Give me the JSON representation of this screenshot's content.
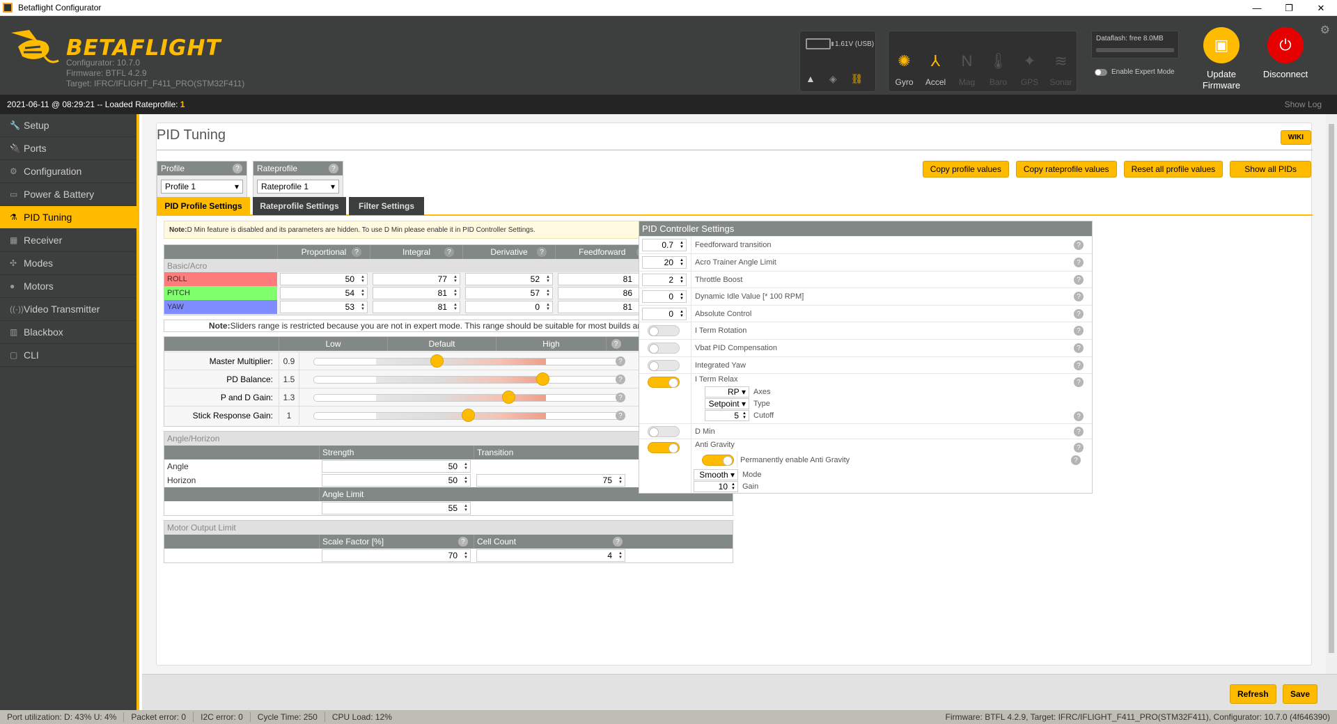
{
  "window": {
    "title": "Betaflight Configurator",
    "minimize": "—",
    "maximize": "❐",
    "close": "✕"
  },
  "header": {
    "logo_text": "BETAFLIGHT",
    "configurator": "Configurator: 10.7.0",
    "firmware": "Firmware: BTFL 4.2.9",
    "target": "Target: IFRC/IFLIGHT_F411_PRO(STM32F411)",
    "battery": "1.61V (USB)",
    "sensors": [
      {
        "label": "Gyro",
        "icon": "gyro-icon",
        "state": "on"
      },
      {
        "label": "Accel",
        "icon": "accel-icon",
        "state": "on"
      },
      {
        "label": "Mag",
        "icon": "mag-icon",
        "state": "off"
      },
      {
        "label": "Baro",
        "icon": "baro-icon",
        "state": "off"
      },
      {
        "label": "GPS",
        "icon": "gps-icon",
        "state": "off"
      },
      {
        "label": "Sonar",
        "icon": "sonar-icon",
        "state": "off"
      }
    ],
    "dataflash": "Dataflash: free 8.0MB",
    "expert_mode": "Enable Expert Mode",
    "update_firmware": "Update Firmware",
    "disconnect": "Disconnect"
  },
  "log": {
    "text": "2021-06-11 @ 08:29:21 -- Loaded Rateprofile: ",
    "value": "1",
    "show_log": "Show Log"
  },
  "sidebar": {
    "items": [
      {
        "label": "Setup",
        "icon": "wrench-icon"
      },
      {
        "label": "Ports",
        "icon": "plug-icon"
      },
      {
        "label": "Configuration",
        "icon": "gear-icon"
      },
      {
        "label": "Power & Battery",
        "icon": "battery-icon"
      },
      {
        "label": "PID Tuning",
        "icon": "pid-icon",
        "active": true
      },
      {
        "label": "Receiver",
        "icon": "receiver-icon"
      },
      {
        "label": "Modes",
        "icon": "modes-icon"
      },
      {
        "label": "Motors",
        "icon": "motor-icon"
      },
      {
        "label": "Video Transmitter",
        "icon": "vtx-icon"
      },
      {
        "label": "Blackbox",
        "icon": "blackbox-icon"
      },
      {
        "label": "CLI",
        "icon": "terminal-icon"
      }
    ]
  },
  "page": {
    "title": "PID Tuning",
    "wiki": "WIKI",
    "profile": {
      "label": "Profile",
      "value": "Profile 1"
    },
    "rateprofile": {
      "label": "Rateprofile",
      "value": "Rateprofile 1"
    },
    "buttons": {
      "copy_profile": "Copy profile values",
      "copy_rateprofile": "Copy rateprofile values",
      "reset_profile": "Reset all profile values",
      "show_all": "Show all PIDs"
    },
    "tabs": [
      "PID Profile Settings",
      "Rateprofile Settings",
      "Filter Settings"
    ]
  },
  "note_dmin": {
    "bold": "Note:",
    "text": " D Min feature is disabled and its parameters are hidden. To use D Min please enable it in PID Controller Settings."
  },
  "pid_table": {
    "columns": [
      "Proportional",
      "Integral",
      "Derivative",
      "Feedforward"
    ],
    "section": "Basic/Acro",
    "rows": [
      {
        "axis": "ROLL",
        "color": "#ff7c7c",
        "values": [
          "50",
          "77",
          "52",
          "81"
        ]
      },
      {
        "axis": "PITCH",
        "color": "#7fff6b",
        "values": [
          "54",
          "81",
          "57",
          "86"
        ]
      },
      {
        "axis": "YAW",
        "color": "#7f8cff",
        "values": [
          "53",
          "81",
          "0",
          "81"
        ]
      }
    ]
  },
  "note_sliders": {
    "bold": "Note:",
    "text": " Sliders range is restricted because you are not in expert mode. This range should be suitable for most builds and beginners."
  },
  "sliders": {
    "headers": [
      "Low",
      "Default",
      "High"
    ],
    "rows": [
      {
        "label": "Master Multiplier:",
        "value": "0.9",
        "level": 0.4
      },
      {
        "label": "PD Balance:",
        "value": "1.5",
        "level": 0.74
      },
      {
        "label": "P and D Gain:",
        "value": "1.3",
        "level": 0.63
      },
      {
        "label": "Stick Response Gain:",
        "value": "1",
        "level": 0.5
      }
    ]
  },
  "angle_horizon": {
    "title": "Angle/Horizon",
    "strength": "Strength",
    "transition": "Transition",
    "angle_label": "Angle",
    "horizon_label": "Horizon",
    "angle_strength": "50",
    "horizon_strength": "50",
    "horizon_transition": "75",
    "angle_limit_label": "Angle Limit",
    "angle_limit": "55"
  },
  "motor_output": {
    "title": "Motor Output Limit",
    "scale_label": "Scale Factor [%]",
    "cell_label": "Cell Count",
    "scale": "70",
    "cells": "4"
  },
  "pid_controller": {
    "title": "PID Controller Settings",
    "feedforward_transition": {
      "value": "0.7",
      "label": "Feedforward transition"
    },
    "acro_trainer": {
      "value": "20",
      "label": "Acro Trainer Angle Limit"
    },
    "throttle_boost": {
      "value": "2",
      "label": "Throttle Boost"
    },
    "dynamic_idle": {
      "value": "0",
      "label": "Dynamic Idle Value [* 100 RPM]"
    },
    "absolute_control": {
      "value": "0",
      "label": "Absolute Control"
    },
    "iterm_rotation": "I Term Rotation",
    "vbat_comp": "Vbat PID Compensation",
    "integrated_yaw": "Integrated Yaw",
    "iterm_relax": {
      "label": "I Term Relax",
      "axes_value": "RP",
      "axes_label": "Axes",
      "type_value": "Setpoint",
      "type_label": "Type",
      "cutoff_value": "5",
      "cutoff_label": "Cutoff"
    },
    "dmin": "D Min",
    "anti_gravity": {
      "label": "Anti Gravity",
      "permanent": "Permanently enable Anti Gravity",
      "mode_value": "Smooth",
      "mode_label": "Mode",
      "gain_value": "10",
      "gain_label": "Gain"
    }
  },
  "bottom": {
    "refresh": "Refresh",
    "save": "Save"
  },
  "status": {
    "port": "Port utilization: D: 43% U: 4%",
    "packet": "Packet error: 0",
    "i2c": "I2C error: 0",
    "cycle": "Cycle Time: 250",
    "cpu": "CPU Load: 12%",
    "firmware": "Firmware: BTFL 4.2.9, Target: IFRC/IFLIGHT_F411_PRO(STM32F411), Configurator: 10.7.0 (4f646390)"
  },
  "colors": {
    "accent": "#ffbb00",
    "header_bg": "#3d3f3e",
    "disconnect": "#e60000"
  }
}
